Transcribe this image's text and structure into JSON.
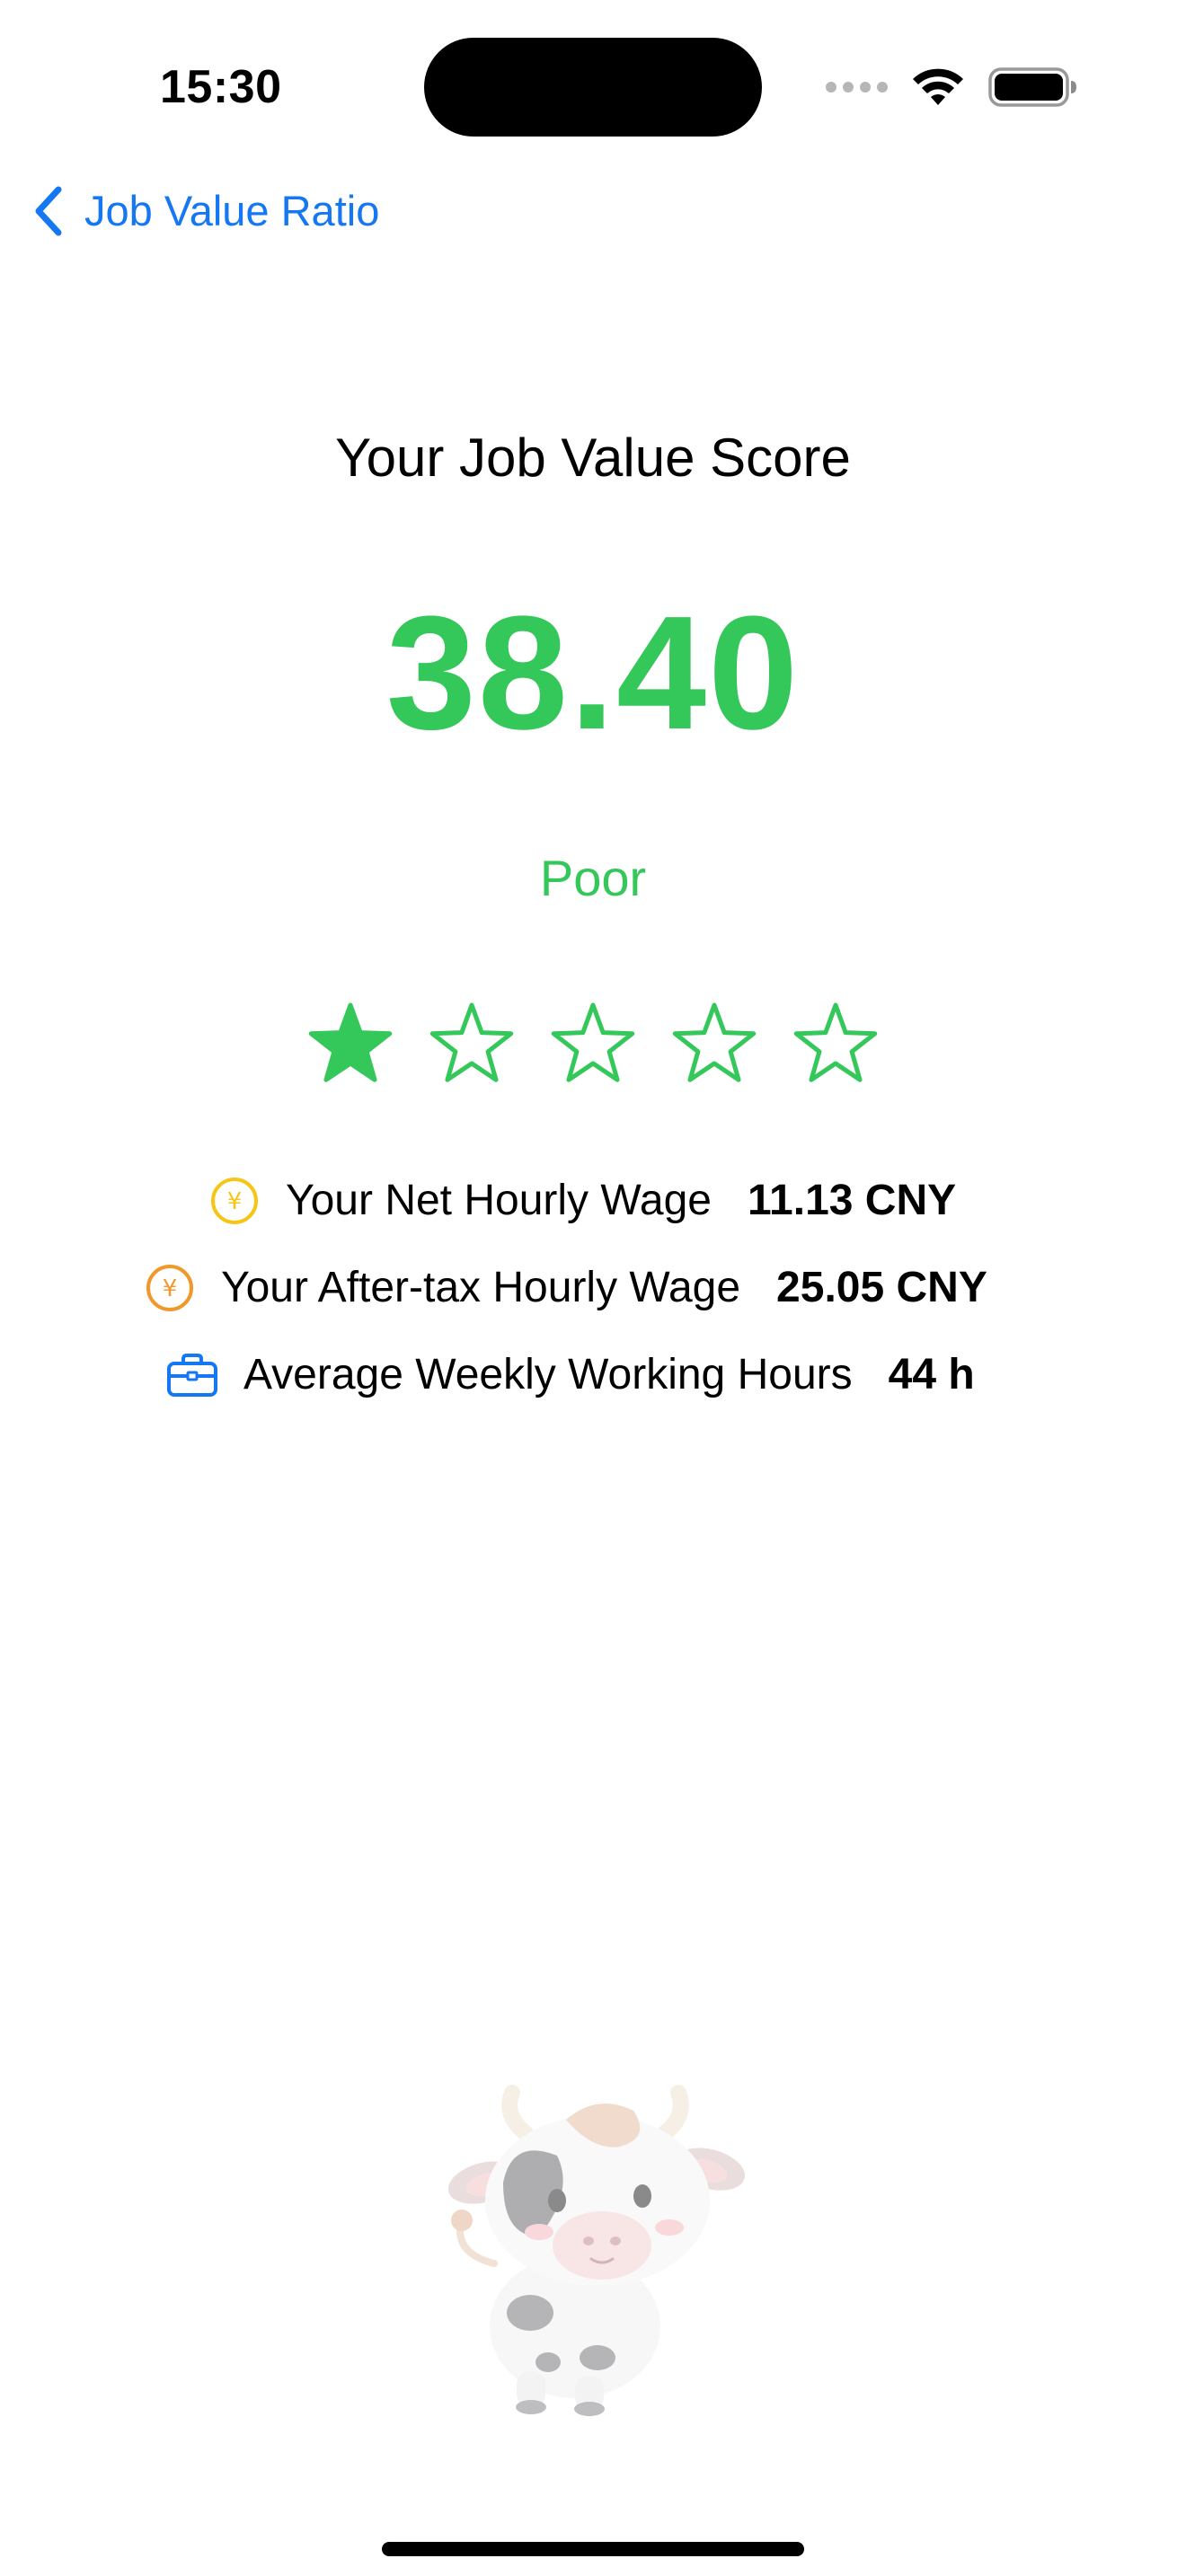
{
  "status_bar": {
    "time": "15:30"
  },
  "nav": {
    "back_label": "Job Value Ratio"
  },
  "result": {
    "title": "Your Job Value Score",
    "score": "38.40",
    "rating_label": "Poor",
    "rating_stars": 1,
    "max_stars": 5
  },
  "stats": [
    {
      "icon": "yen-circle-icon",
      "label": "Your Net Hourly Wage",
      "value": "11.13 CNY",
      "icon_color": "#f5c518"
    },
    {
      "icon": "yen-circle-icon",
      "label": "Your After-tax Hourly Wage",
      "value": "25.05 CNY",
      "icon_color": "#f0982c"
    },
    {
      "icon": "briefcase-icon",
      "label": "Average Weekly Working Hours",
      "value": "44 h",
      "icon_color": "#1677f2"
    }
  ],
  "colors": {
    "accent": "#1677f2",
    "score_green": "#34c759"
  }
}
